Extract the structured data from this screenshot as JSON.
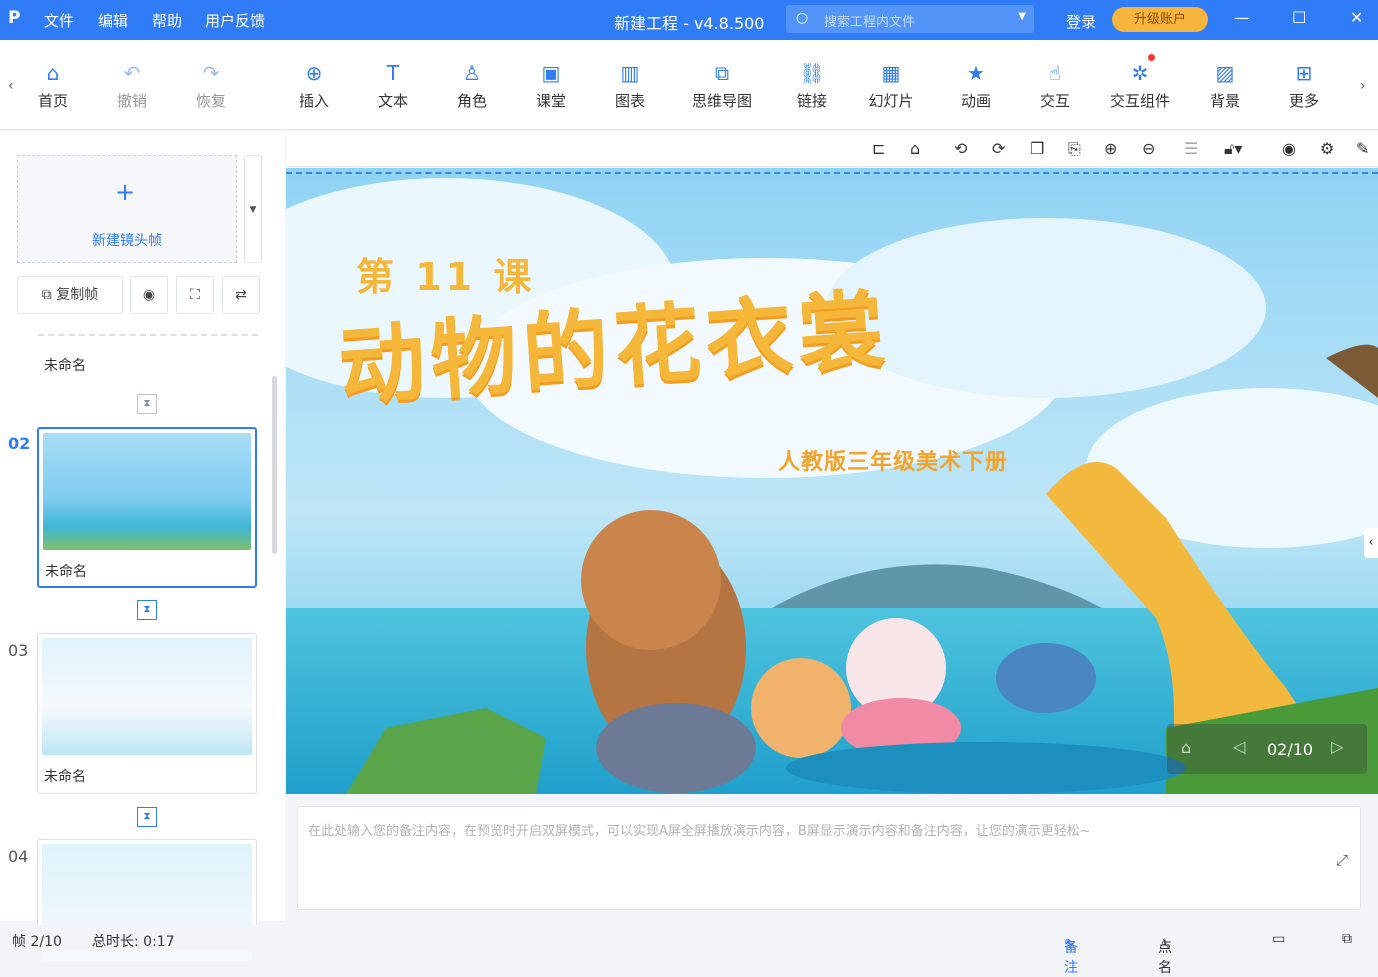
{
  "titlebar": {
    "logo": "P",
    "menus": [
      "文件",
      "编辑",
      "帮助",
      "用户反馈"
    ],
    "title": "新建工程 - v4.8.500",
    "search_placeholder": "搜索工程内文件",
    "login": "登录",
    "upgrade": "升级账户"
  },
  "toolbar": {
    "items": [
      {
        "label": "首页",
        "icon": "home-icon"
      },
      {
        "label": "撤销",
        "icon": "undo-icon"
      },
      {
        "label": "恢复",
        "icon": "redo-icon"
      },
      {
        "label": "插入",
        "icon": "plus-icon"
      },
      {
        "label": "文本",
        "icon": "text-icon"
      },
      {
        "label": "角色",
        "icon": "role-icon"
      },
      {
        "label": "课堂",
        "icon": "classroom-icon"
      },
      {
        "label": "图表",
        "icon": "chart-icon"
      },
      {
        "label": "思维导图",
        "icon": "mindmap-icon"
      },
      {
        "label": "链接",
        "icon": "link-icon"
      },
      {
        "label": "幻灯片",
        "icon": "slide-icon"
      },
      {
        "label": "动画",
        "icon": "animation-icon"
      },
      {
        "label": "交互",
        "icon": "interaction-icon"
      },
      {
        "label": "交互组件",
        "icon": "component-icon"
      },
      {
        "label": "背景",
        "icon": "background-icon"
      },
      {
        "label": "更多",
        "icon": "more-icon"
      }
    ]
  },
  "panel": {
    "new_frame": "新建镜头帧",
    "copy_frame": "复制帧",
    "frames": [
      {
        "num": "",
        "name": "未命名"
      },
      {
        "num": "02",
        "name": "未命名"
      },
      {
        "num": "03",
        "name": "未命名"
      },
      {
        "num": "04",
        "name": ""
      }
    ]
  },
  "slide": {
    "lesson": "第 11 课",
    "title": "动物的花衣裳",
    "subtitle": "人教版三年级美术下册",
    "counter": "02/10"
  },
  "notes": {
    "placeholder": "在此处输入您的备注内容，在预览时开启双屏模式，可以实现A屏全屏播放演示内容，B屏显示演示内容和备注内容，让您的演示更轻松~"
  },
  "status": {
    "frame": "帧 2/10",
    "duration": "总时长: 0:17",
    "notes": "备注",
    "rollcall": "点名"
  },
  "colors": {
    "accent": "#2f7cf6",
    "upgrade": "#f6b53d",
    "slide_title": "#f5b73a"
  }
}
